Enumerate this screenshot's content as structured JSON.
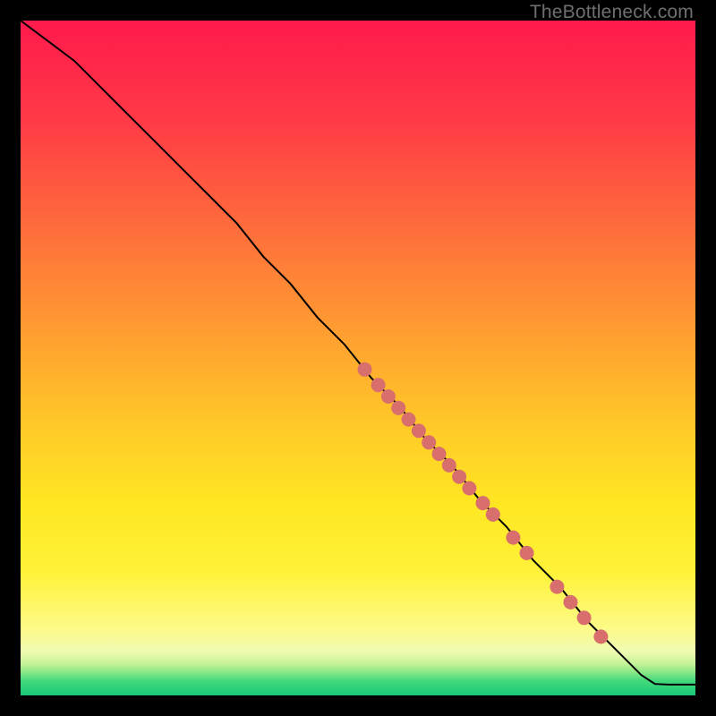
{
  "watermark": "TheBottleneck.com",
  "colors": {
    "dot": "#d86f6d",
    "line": "#000000",
    "green_band_top": "#b2ee7d",
    "green_band_mid": "#59e27b",
    "green_band_bottom": "#1ccd78"
  },
  "chart_data": {
    "type": "line",
    "title": "",
    "xlabel": "",
    "ylabel": "",
    "xlim": [
      0,
      100
    ],
    "ylim": [
      0,
      100
    ],
    "series": [
      {
        "name": "curve",
        "x": [
          0,
          4,
          8,
          12,
          16,
          20,
          24,
          28,
          32,
          36,
          40,
          44,
          48,
          52,
          56,
          60,
          64,
          68,
          72,
          76,
          80,
          84,
          88,
          92,
          94,
          96,
          100
        ],
        "y": [
          100,
          97,
          94,
          90,
          86,
          82,
          78,
          74,
          70,
          65,
          61,
          56,
          52,
          47,
          43,
          38,
          34,
          29,
          25,
          20,
          16,
          11,
          7,
          3,
          1.7,
          1.6,
          1.6
        ]
      }
    ],
    "scatter": [
      {
        "name": "highlight-dots",
        "x": [
          51,
          53,
          54.5,
          56,
          57.5,
          59,
          60.5,
          62,
          63.5,
          65,
          66.5,
          68.5,
          70,
          73,
          75,
          79.5,
          81.5,
          83.5,
          86
        ],
        "y": [
          48.3,
          46.0,
          44.3,
          42.6,
          40.9,
          39.2,
          37.5,
          35.8,
          34.1,
          32.4,
          30.7,
          28.5,
          26.8,
          23.4,
          21.1,
          16.1,
          13.8,
          11.5,
          8.7
        ]
      }
    ],
    "gradient_stops": [
      {
        "pct": 0.0,
        "color": "#ff1a4c"
      },
      {
        "pct": 0.15,
        "color": "#ff3a46"
      },
      {
        "pct": 0.3,
        "color": "#ff6a3c"
      },
      {
        "pct": 0.45,
        "color": "#ff9a32"
      },
      {
        "pct": 0.6,
        "color": "#ffc928"
      },
      {
        "pct": 0.72,
        "color": "#ffe722"
      },
      {
        "pct": 0.82,
        "color": "#fff23a"
      },
      {
        "pct": 0.9,
        "color": "#fdfa87"
      },
      {
        "pct": 0.935,
        "color": "#f0fbb3"
      },
      {
        "pct": 0.952,
        "color": "#c9f39a"
      },
      {
        "pct": 0.965,
        "color": "#8de887"
      },
      {
        "pct": 0.978,
        "color": "#45d97c"
      },
      {
        "pct": 1.0,
        "color": "#18c877"
      }
    ]
  }
}
